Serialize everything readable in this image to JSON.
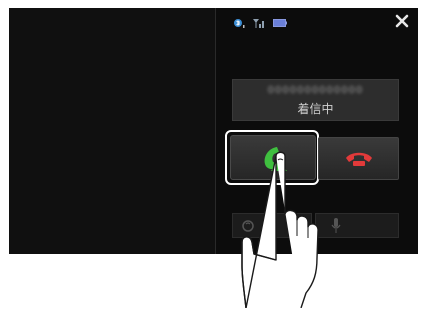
{
  "call": {
    "caller_number": "0000000000000",
    "status": "着信中"
  },
  "icons": {
    "bluetooth": "bluetooth-icon",
    "signal": "signal-icon",
    "battery": "battery-icon",
    "close": "close-icon",
    "answer": "phone-answer-icon",
    "decline": "phone-decline-icon",
    "handsfree": "handsfree-icon",
    "mic": "microphone-icon"
  },
  "colors": {
    "answer": "#3fbf3f",
    "decline": "#e23a3a",
    "background": "#0c0c0c"
  }
}
